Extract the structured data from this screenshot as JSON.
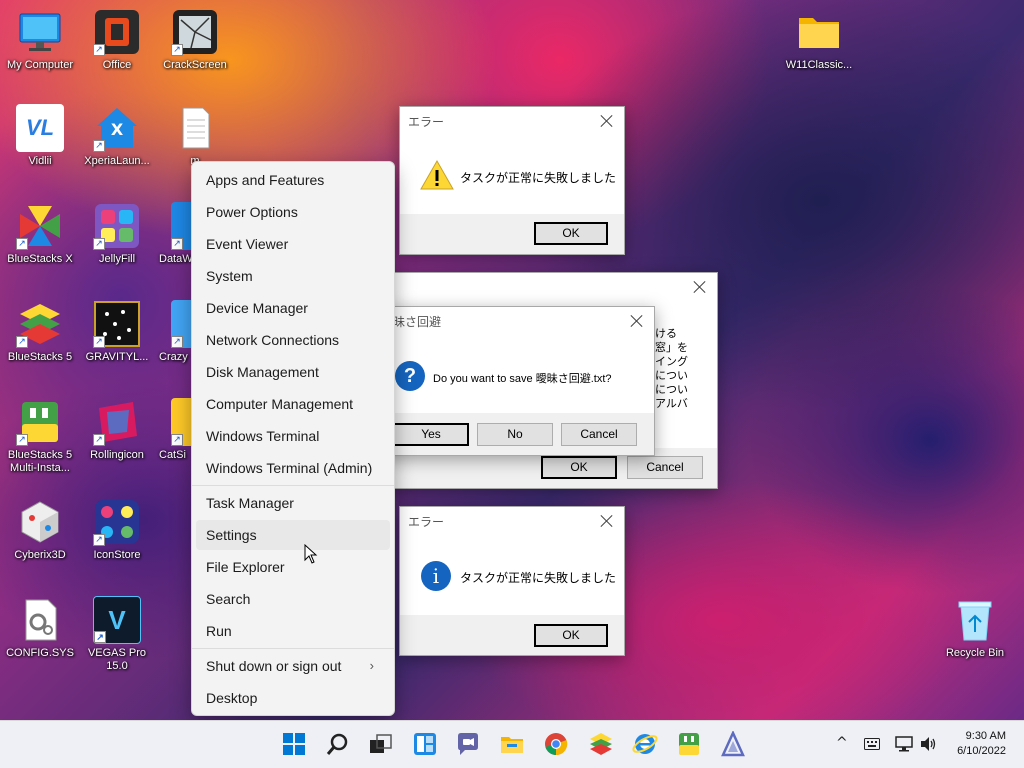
{
  "desktop_icons": [
    {
      "label": "My Computer",
      "icon": "monitor-icon"
    },
    {
      "label": "Office",
      "icon": "office-icon"
    },
    {
      "label": "CrackScreen",
      "icon": "crackscreen-icon"
    },
    {
      "label": "W11Classic...",
      "icon": "folder-icon"
    },
    {
      "label": "Vidlii",
      "icon": "vidlii-icon"
    },
    {
      "label": "XperiaLaun...",
      "icon": "xperia-icon"
    },
    {
      "label": "m",
      "icon": "text-file-icon"
    },
    {
      "label": "BlueStacks X",
      "icon": "bluestacks-x-icon"
    },
    {
      "label": "JellyFill",
      "icon": "jellyfill-icon"
    },
    {
      "label": "DataW",
      "icon": "app-icon"
    },
    {
      "label": "BlueStacks 5",
      "icon": "bluestacks-icon"
    },
    {
      "label": "GRAVITYL...",
      "icon": "gravity-icon"
    },
    {
      "label": "Crazy",
      "icon": "app-icon"
    },
    {
      "label": "BlueStacks 5 Multi-Insta...",
      "icon": "bluestacks-multi-icon"
    },
    {
      "label": "Rollingicon",
      "icon": "rollingicon-icon"
    },
    {
      "label": "CatSi",
      "icon": "cat-icon"
    },
    {
      "label": "Cyberix3D",
      "icon": "cyberix3d-icon"
    },
    {
      "label": "IconStore",
      "icon": "iconstore-icon"
    },
    {
      "label": "CONFIG.SYS",
      "icon": "config-file-icon"
    },
    {
      "label": "VEGAS Pro 15.0",
      "icon": "vegas-icon"
    },
    {
      "label": "Recycle Bin",
      "icon": "recycle-bin-icon"
    }
  ],
  "icon_glyphs": {
    "vidlii": "VL",
    "xperia": "X",
    "vegas": "V"
  },
  "dialog_error_warning": {
    "title": "エラー",
    "message": "タスクが正常に失敗しました",
    "ok_label": "OK",
    "icon": "warning-icon"
  },
  "dialog_back": {
    "side_text": [
      "ける",
      "窓」を",
      "イング",
      "につい",
      "につい",
      "アルバ"
    ],
    "ok_label": "OK",
    "cancel_label": "Cancel"
  },
  "dialog_save": {
    "title": "昧さ回避",
    "message": "Do you want to save 曖昧さ回避.txt?",
    "question_glyph": "?",
    "yes_label": "Yes",
    "no_label": "No",
    "cancel_label": "Cancel",
    "icon": "question-icon"
  },
  "dialog_error_info": {
    "title": "エラー",
    "message": "タスクが正常に失敗しました",
    "ok_label": "OK",
    "info_glyph": "i",
    "icon": "info-icon"
  },
  "context_menu": {
    "items": [
      "Apps and Features",
      "Power Options",
      "Event Viewer",
      "System",
      "Device Manager",
      "Network Connections",
      "Disk Management",
      "Computer Management",
      "Windows Terminal",
      "Windows Terminal (Admin)",
      "Task Manager",
      "Settings",
      "File Explorer",
      "Search",
      "Run",
      "Shut down or sign out",
      "Desktop"
    ],
    "hovered": "Settings",
    "submenu_chevron": "›"
  },
  "taskbar": {
    "icons": [
      "start-icon",
      "search-icon",
      "task-view-icon",
      "widgets-icon",
      "chat-icon",
      "file-explorer-icon",
      "chrome-icon",
      "bluestacks-icon",
      "internet-explorer-icon",
      "bluestacks-multi-icon",
      "app-icon"
    ],
    "time": "9:30 AM",
    "date": "6/10/2022",
    "tray_chevron": "^"
  }
}
